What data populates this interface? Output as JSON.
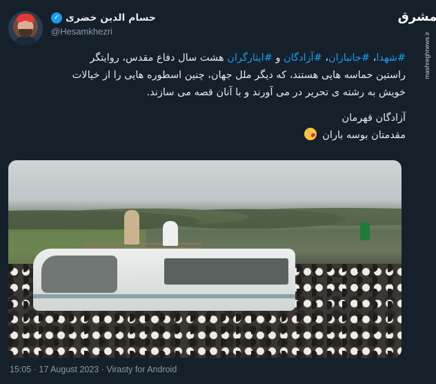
{
  "author": {
    "display_name": "حسام الدین خضری",
    "handle": "@Hesamkhezri",
    "verified_icon": "verified-badge-icon"
  },
  "brand": {
    "logo_text": "مشرق",
    "url": "mashreghnews.ir"
  },
  "tweet": {
    "tags": [
      "#شهدا",
      "#جانبازان",
      "#آزادگان",
      "#ایثارگران"
    ],
    "sep1": "، ",
    "sep2": "، ",
    "and_word": " و ",
    "line1_rest": " هشت سال دفاع مقدس، روایتگر",
    "line2": "راستین حماسه هایی هستند، که دیگر ملل جهان، چنین اسطوره هایی را از خیالات",
    "line3": "خویش به رشته ی تحریر در می آورند و با آنان قصه می سازند.",
    "line4": "آزادگان قهرمان",
    "line5": "مقدمتان بوسه باران"
  },
  "footer": {
    "text": "15:05 · 17 August 2023 · Virasty for Android"
  },
  "colors": {
    "background": "#15202b",
    "hashtag": "#1d9bf0",
    "muted": "#8b98a5"
  }
}
